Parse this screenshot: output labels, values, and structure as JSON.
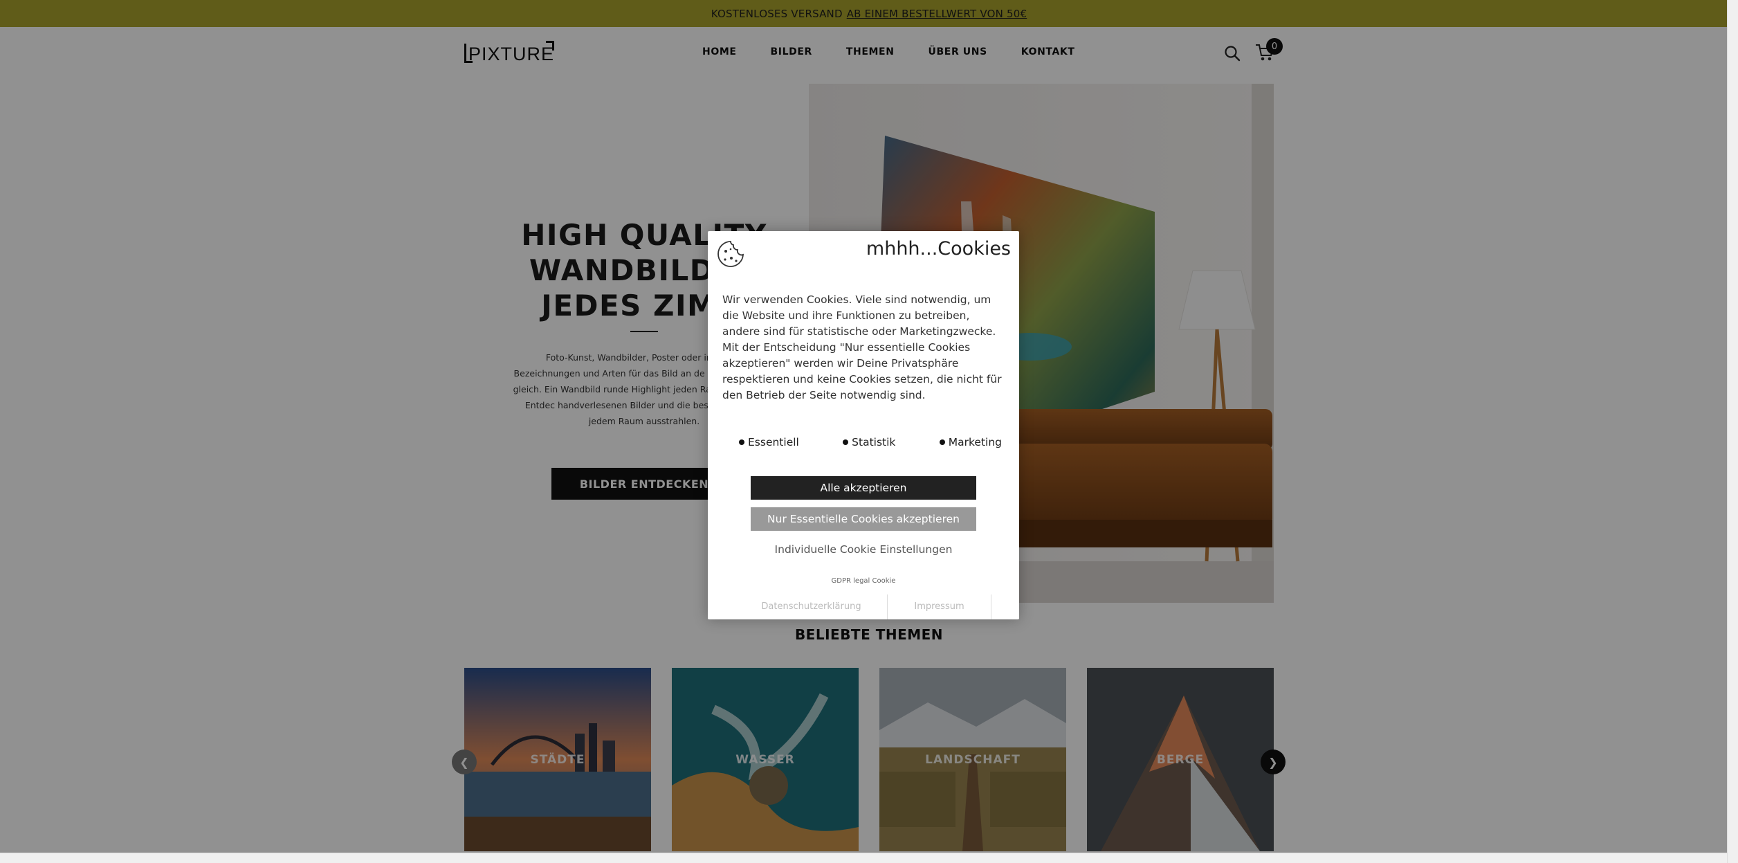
{
  "banner": {
    "text": "KOSTENLOSES VERSAND",
    "link": "AB EINEM BESTELLWERT VON 50€"
  },
  "header": {
    "logo": "PIXTURE",
    "nav": [
      "HOME",
      "BILDER",
      "THEMEN",
      "ÜBER UNS",
      "KONTAKT"
    ],
    "cart_count": "0",
    "icons": [
      "search-icon",
      "cart-icon"
    ]
  },
  "hero": {
    "title_line1": "HIGH QUALITY",
    "title_line2": "WANDBILDER",
    "title_line3": "JEDES ZIMM",
    "text": "Foto-Kunst, Wandbilder, Poster oder im Rahm Bezeichnungen und Arten für das Bild an de eines ist immer gleich. Ein Wandbild runde Highlight jeden Raum perfekt ab. Entdec handverlesenen Bilder und die besondere Sti in jedem Raum ausstrahlen.",
    "button": "BILDER ENTDECKEN"
  },
  "themes": {
    "title": "BELIEBTE THEMEN",
    "items": [
      "STÄDTE",
      "WASSER",
      "LANDSCHAFT",
      "BERGE"
    ]
  },
  "cookie": {
    "title": "mhhh...Cookies",
    "text": "Wir verwenden Cookies. Viele sind notwendig, um die Website und ihre Funktionen zu betreiben, andere sind für statistische oder Marketingzwecke. Mit der Entscheidung \"Nur essentielle Cookies akzeptieren\" werden wir Deine Privatsphäre respektieren und keine Cookies setzen, die nicht für den Betrieb der Seite notwendig sind.",
    "options": [
      "Essentiell",
      "Statistik",
      "Marketing"
    ],
    "accept_all": "Alle akzeptieren",
    "accept_essential": "Nur Essentielle Cookies akzeptieren",
    "individual": "Individuelle Cookie Einstellungen",
    "gdpr": "GDPR legal Cookie",
    "privacy": "Datenschutzerklärung",
    "imprint": "Impressum"
  },
  "colors": {
    "banner": "#a9a32c",
    "button_dark": "#111111",
    "button_grey": "#999999"
  }
}
